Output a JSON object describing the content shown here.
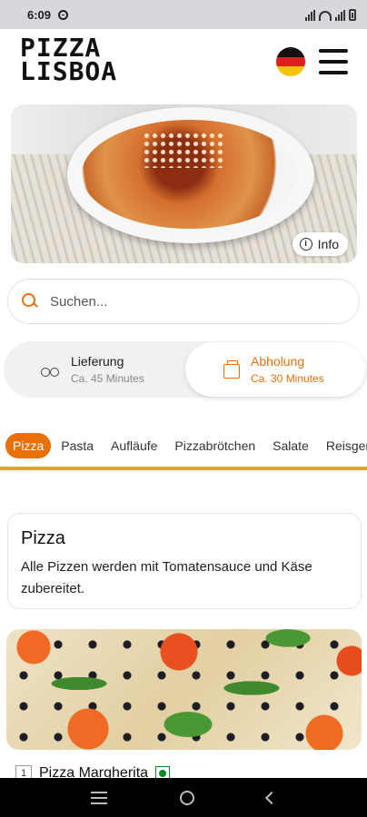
{
  "status_bar": {
    "time": "6:09"
  },
  "header": {
    "logo_line1": "PIZZA",
    "logo_line2": "LISBOA",
    "flag_colors": [
      "#111111",
      "#dd1f1f",
      "#f7c300"
    ],
    "flag_icon": "germany-flag-icon",
    "menu_icon": "hamburger-menu-icon"
  },
  "hero": {
    "info_label": "Info"
  },
  "search": {
    "placeholder": "Suchen..."
  },
  "delivery_options": {
    "delivery": {
      "label": "Lieferung",
      "time": "Ca. 45 Minutes"
    },
    "pickup": {
      "label": "Abholung",
      "time": "Ca. 30 Minutes",
      "selected": true
    }
  },
  "categories": [
    "Pizza",
    "Pasta",
    "Aufläufe",
    "Pizzabrötchen",
    "Salate",
    "Reisgerichte"
  ],
  "active_category": "Pizza",
  "category_card": {
    "title": "Pizza",
    "description": "Alle Pizzen werden mit Tomatensauce und Käse zubereitet."
  },
  "products": [
    {
      "number": "1",
      "name": "Pizza Margherita",
      "vegetarian": true
    }
  ],
  "colors": {
    "accent": "#e8700a",
    "veg": "#0c8a2a"
  }
}
